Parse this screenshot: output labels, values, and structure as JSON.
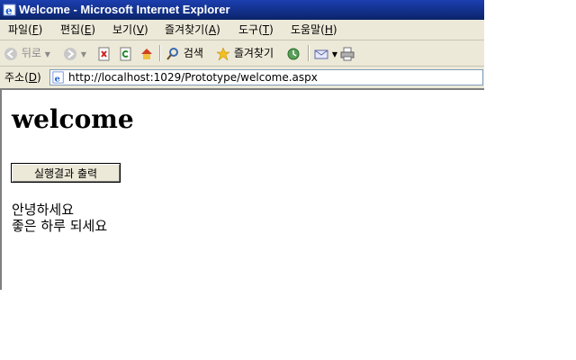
{
  "window": {
    "title": "Welcome - Microsoft Internet Explorer"
  },
  "menu": {
    "items": [
      {
        "label": "파일(",
        "key": "F",
        "tail": ")"
      },
      {
        "label": "편집(",
        "key": "E",
        "tail": ")"
      },
      {
        "label": "보기(",
        "key": "V",
        "tail": ")"
      },
      {
        "label": "즐겨찾기(",
        "key": "A",
        "tail": ")"
      },
      {
        "label": "도구(",
        "key": "T",
        "tail": ")"
      },
      {
        "label": "도움말(",
        "key": "H",
        "tail": ")"
      }
    ]
  },
  "toolbar": {
    "back_label": "뒤로",
    "search_label": "검색",
    "favorites_label": "즐겨찾기"
  },
  "address": {
    "label_prefix": "주소(",
    "label_key": "D",
    "label_suffix": ")",
    "url": "http://localhost:1029/Prototype/welcome.aspx"
  },
  "page": {
    "heading": "welcome",
    "button_label": "실행결과 출력",
    "lines": [
      "안녕하세요",
      "좋은 하루 되세요"
    ]
  },
  "colors": {
    "titlebar": "#0a246a",
    "chrome": "#ece9d8"
  }
}
